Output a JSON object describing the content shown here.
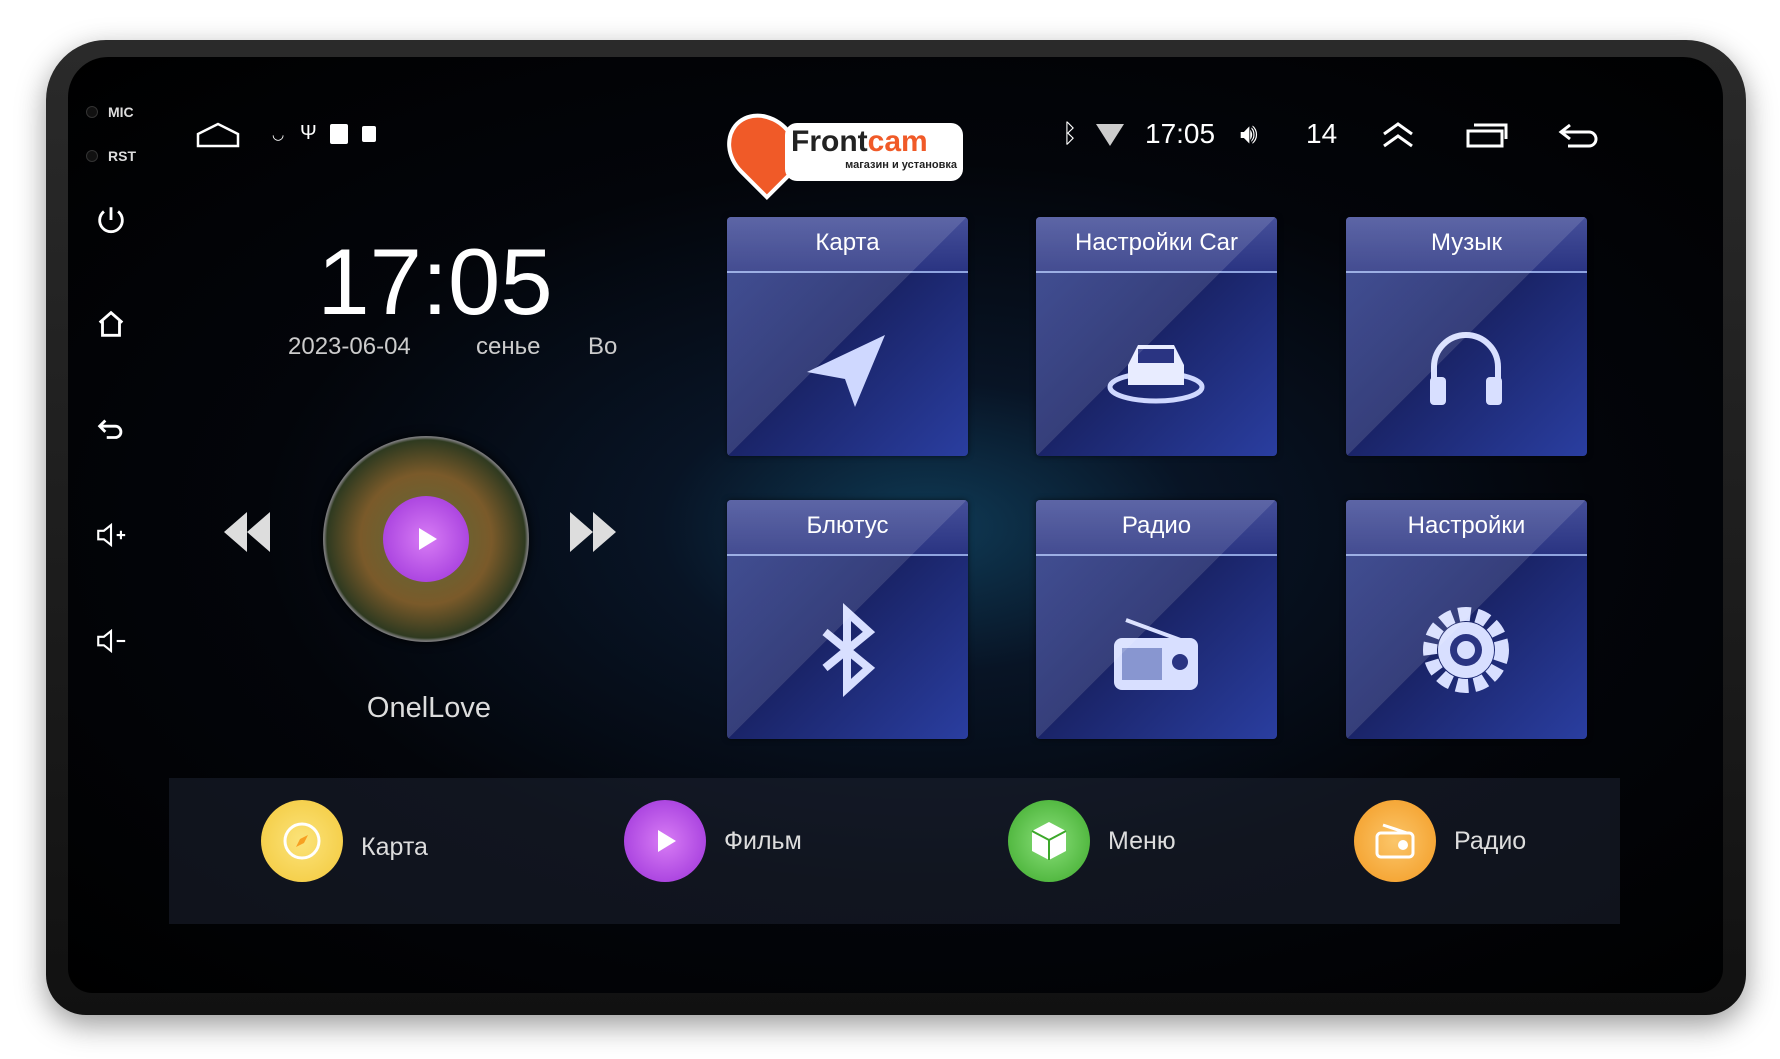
{
  "hardware": {
    "mic": "MIC",
    "rst": "RST"
  },
  "status": {
    "time": "17:05",
    "volume": "14"
  },
  "logo": {
    "name": "Frontcam",
    "tagline": "магазин и установка"
  },
  "clock": {
    "time": "17:05",
    "date": "2023-06-04",
    "weekday_partial": "сенье",
    "extra_partial": "Во"
  },
  "media": {
    "track": "OnelLove"
  },
  "tiles": [
    {
      "label": "Карта",
      "icon": "navigation-icon"
    },
    {
      "label": "Настройки Car",
      "icon": "car-icon"
    },
    {
      "label": "Музык",
      "icon": "headphones-icon"
    },
    {
      "label": "Блютус",
      "icon": "bluetooth-icon"
    },
    {
      "label": "Радио",
      "icon": "radio-icon"
    },
    {
      "label": "Настройки",
      "icon": "gear-icon"
    }
  ],
  "dock": [
    {
      "label": "Карта",
      "color": "#f3c83a"
    },
    {
      "label": "Фильм",
      "color": "#b250e8"
    },
    {
      "label": "Меню",
      "color": "#4cc23a"
    },
    {
      "label": "Радио",
      "color": "#f6a22a"
    }
  ],
  "colors": {
    "brand": "#f05a28",
    "tile": "#1f2a78"
  }
}
